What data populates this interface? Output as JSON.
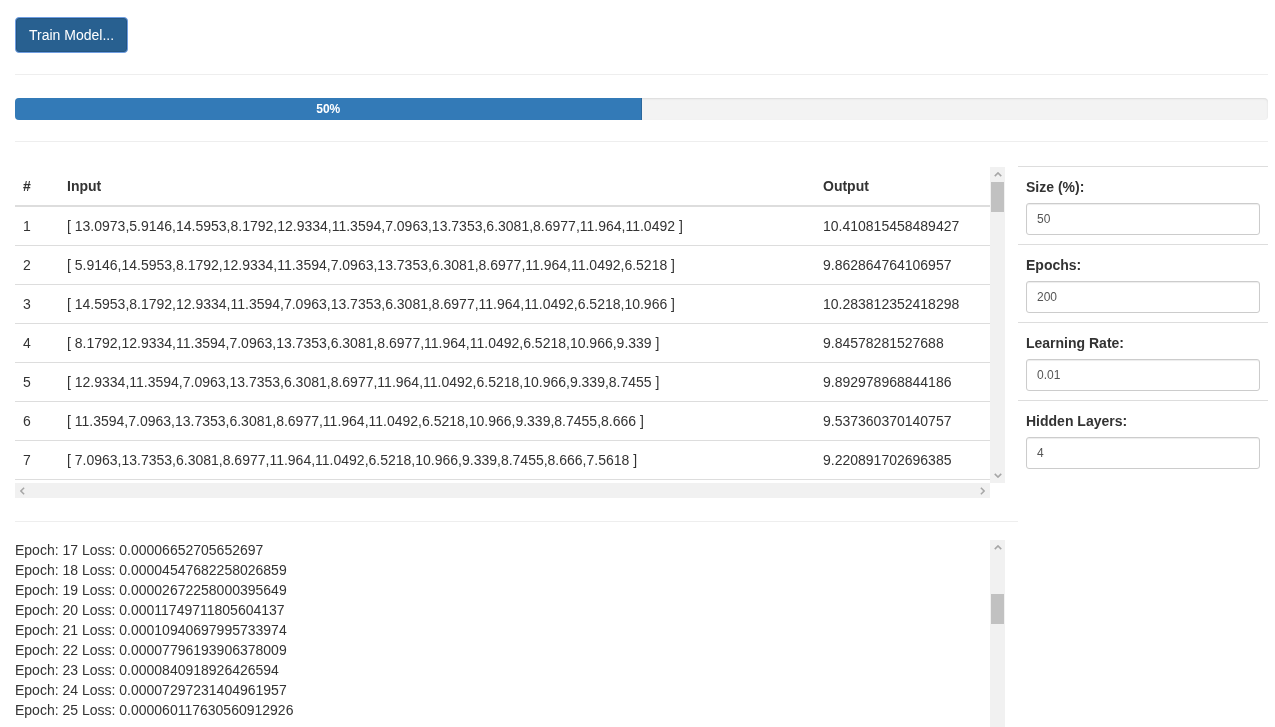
{
  "toolbar": {
    "train_button": "Train Model..."
  },
  "progress": {
    "level": 0.5,
    "label": "50%"
  },
  "table": {
    "columns": [
      "#",
      "Input",
      "Output"
    ],
    "rows": [
      {
        "index": "1",
        "input": "[ 13.0973,5.9146,14.5953,8.1792,12.9334,11.3594,7.0963,13.7353,6.3081,8.6977,11.964,11.0492 ]",
        "output": "10.410815458489427"
      },
      {
        "index": "2",
        "input": "[ 5.9146,14.5953,8.1792,12.9334,11.3594,7.0963,13.7353,6.3081,8.6977,11.964,11.0492,6.5218 ]",
        "output": "9.862864764106957"
      },
      {
        "index": "3",
        "input": "[ 14.5953,8.1792,12.9334,11.3594,7.0963,13.7353,6.3081,8.6977,11.964,11.0492,6.5218,10.966 ]",
        "output": "10.283812352418298"
      },
      {
        "index": "4",
        "input": "[ 8.1792,12.9334,11.3594,7.0963,13.7353,6.3081,8.6977,11.964,11.0492,6.5218,10.966,9.339 ]",
        "output": "9.84578281527688"
      },
      {
        "index": "5",
        "input": "[ 12.9334,11.3594,7.0963,13.7353,6.3081,8.6977,11.964,11.0492,6.5218,10.966,9.339,8.7455 ]",
        "output": "9.892978968844186"
      },
      {
        "index": "6",
        "input": "[ 11.3594,7.0963,13.7353,6.3081,8.6977,11.964,11.0492,6.5218,10.966,9.339,8.7455,8.666 ]",
        "output": "9.537360370140757"
      },
      {
        "index": "7",
        "input": "[ 7.0963,13.7353,6.3081,8.6977,11.964,11.0492,6.5218,10.966,9.339,8.7455,8.666,7.5618 ]",
        "output": "9.220891702696385"
      }
    ]
  },
  "settings": [
    {
      "label": "Size (%):",
      "value": "50"
    },
    {
      "label": "Epochs:",
      "value": "200"
    },
    {
      "label": "Learning Rate:",
      "value": "0.01"
    },
    {
      "label": "Hidden Layers:",
      "value": "4"
    }
  ],
  "log": {
    "lines": [
      "Epoch: 17 Loss: 0.00006652705652697",
      "Epoch: 18 Loss: 0.00004547682258026859",
      "Epoch: 19 Loss: 0.00002672258000395649",
      "Epoch: 20 Loss: 0.00011749711805604137",
      "Epoch: 21 Loss: 0.00010940697995733974",
      "Epoch: 22 Loss: 0.00007796193906378009",
      "Epoch: 23 Loss: 0.0000840918926426594",
      "Epoch: 24 Loss: 0.00007297231404961957",
      "Epoch: 25 Loss: 0.000060117630560912926"
    ]
  }
}
